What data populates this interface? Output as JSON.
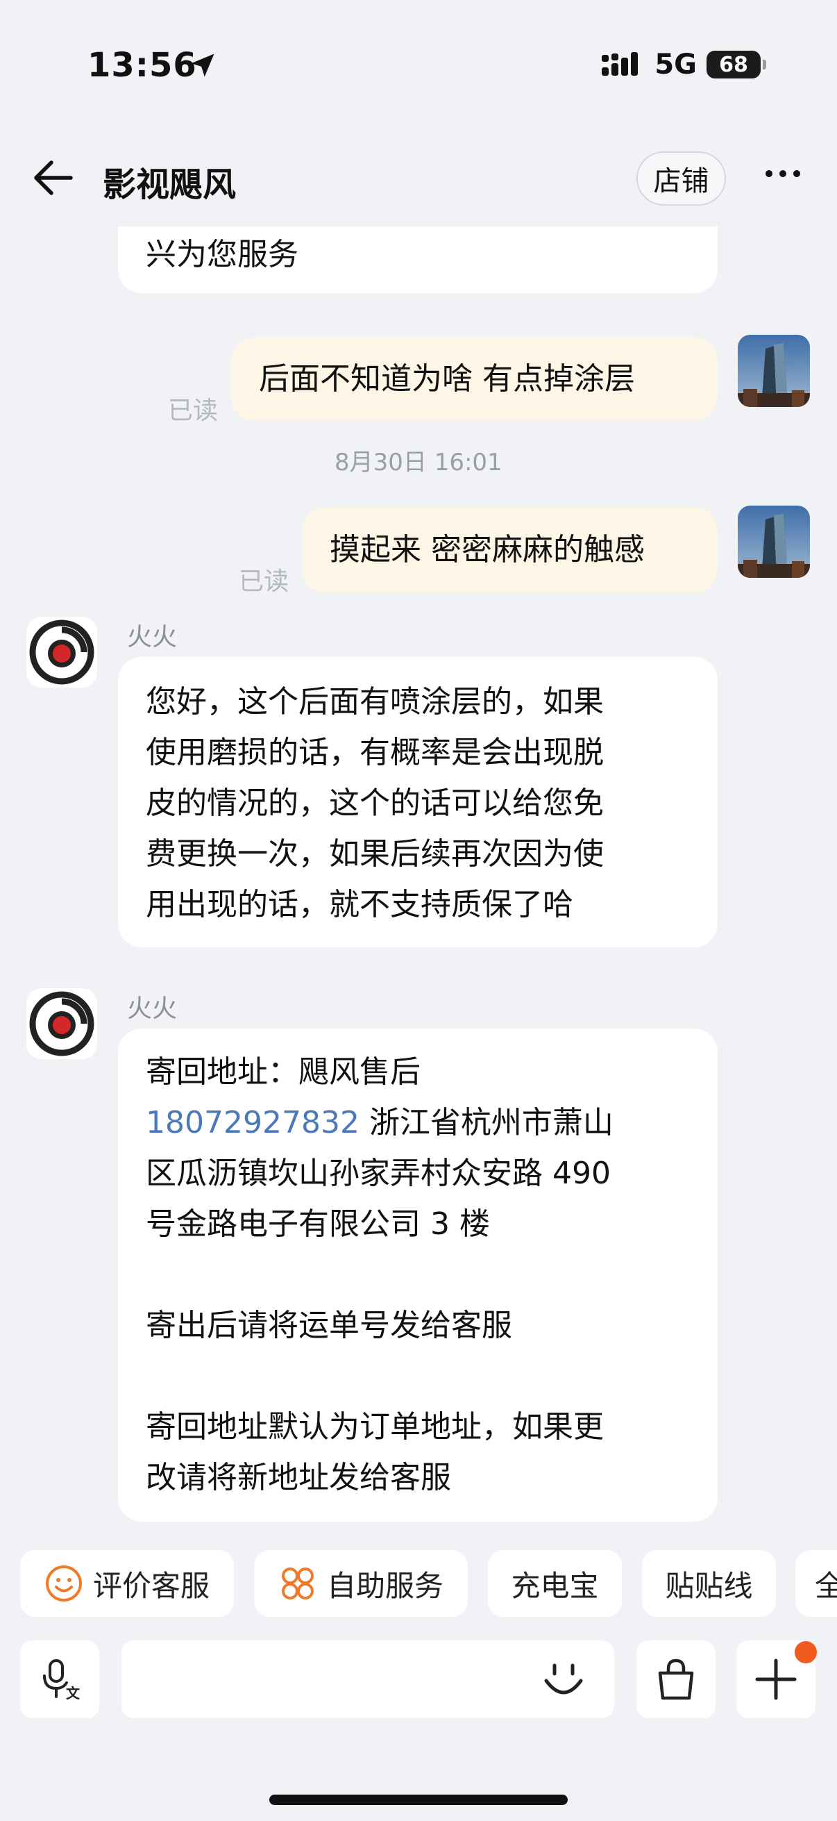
{
  "status_bar": {
    "time": "13:56",
    "network": "5G",
    "battery": "68"
  },
  "header": {
    "title": "影视飓风",
    "store_label": "店铺"
  },
  "messages": [
    {
      "side": "shop",
      "lines": [
        "兴为您服务"
      ]
    },
    {
      "side": "user",
      "text": "后面不知道为啥 有点掉涂层",
      "read": "已读"
    },
    {
      "timestamp": "8月30日 16:01"
    },
    {
      "side": "user",
      "text": "摸起来 密密麻麻的触感",
      "read": "已读"
    },
    {
      "side": "shop",
      "sender": "火火",
      "lines": [
        "您好，这个后面有喷涂层的，如果",
        "使用磨损的话，有概率是会出现脱",
        "皮的情况的，这个的话可以给您免",
        "费更换一次，如果后续再次因为使",
        "用出现的话，就不支持质保了哈"
      ]
    },
    {
      "side": "shop",
      "sender": "火火",
      "lines": [
        "寄回地址：飓风售后",
        "浙江省杭州市萧山",
        "区瓜沥镇坎山孙家弄村众安路 490",
        "号金路电子有限公司 3 楼",
        "",
        "寄出后请将运单号发给客服",
        "",
        "寄回地址默认为订单地址，如果更",
        "改请将新地址发给客服"
      ],
      "phone": "18072927832"
    }
  ],
  "quick_actions": [
    {
      "label": "评价客服",
      "icon": "smile-icon"
    },
    {
      "label": "自助服务",
      "icon": "grid-flower-icon"
    },
    {
      "label": "充电宝"
    },
    {
      "label": "贴贴线"
    },
    {
      "label": "全"
    }
  ],
  "input_bar": {
    "voice_icon": "voice-translate-icon",
    "emoji_icon": "emoji-icon",
    "shop_icon": "shopping-bag-icon",
    "plus_icon": "plus-icon"
  },
  "colors": {
    "accent": "#f07a2a",
    "link": "#4a78b8",
    "user_bubble": "#fdf5e6",
    "background": "#f0f2f6"
  }
}
